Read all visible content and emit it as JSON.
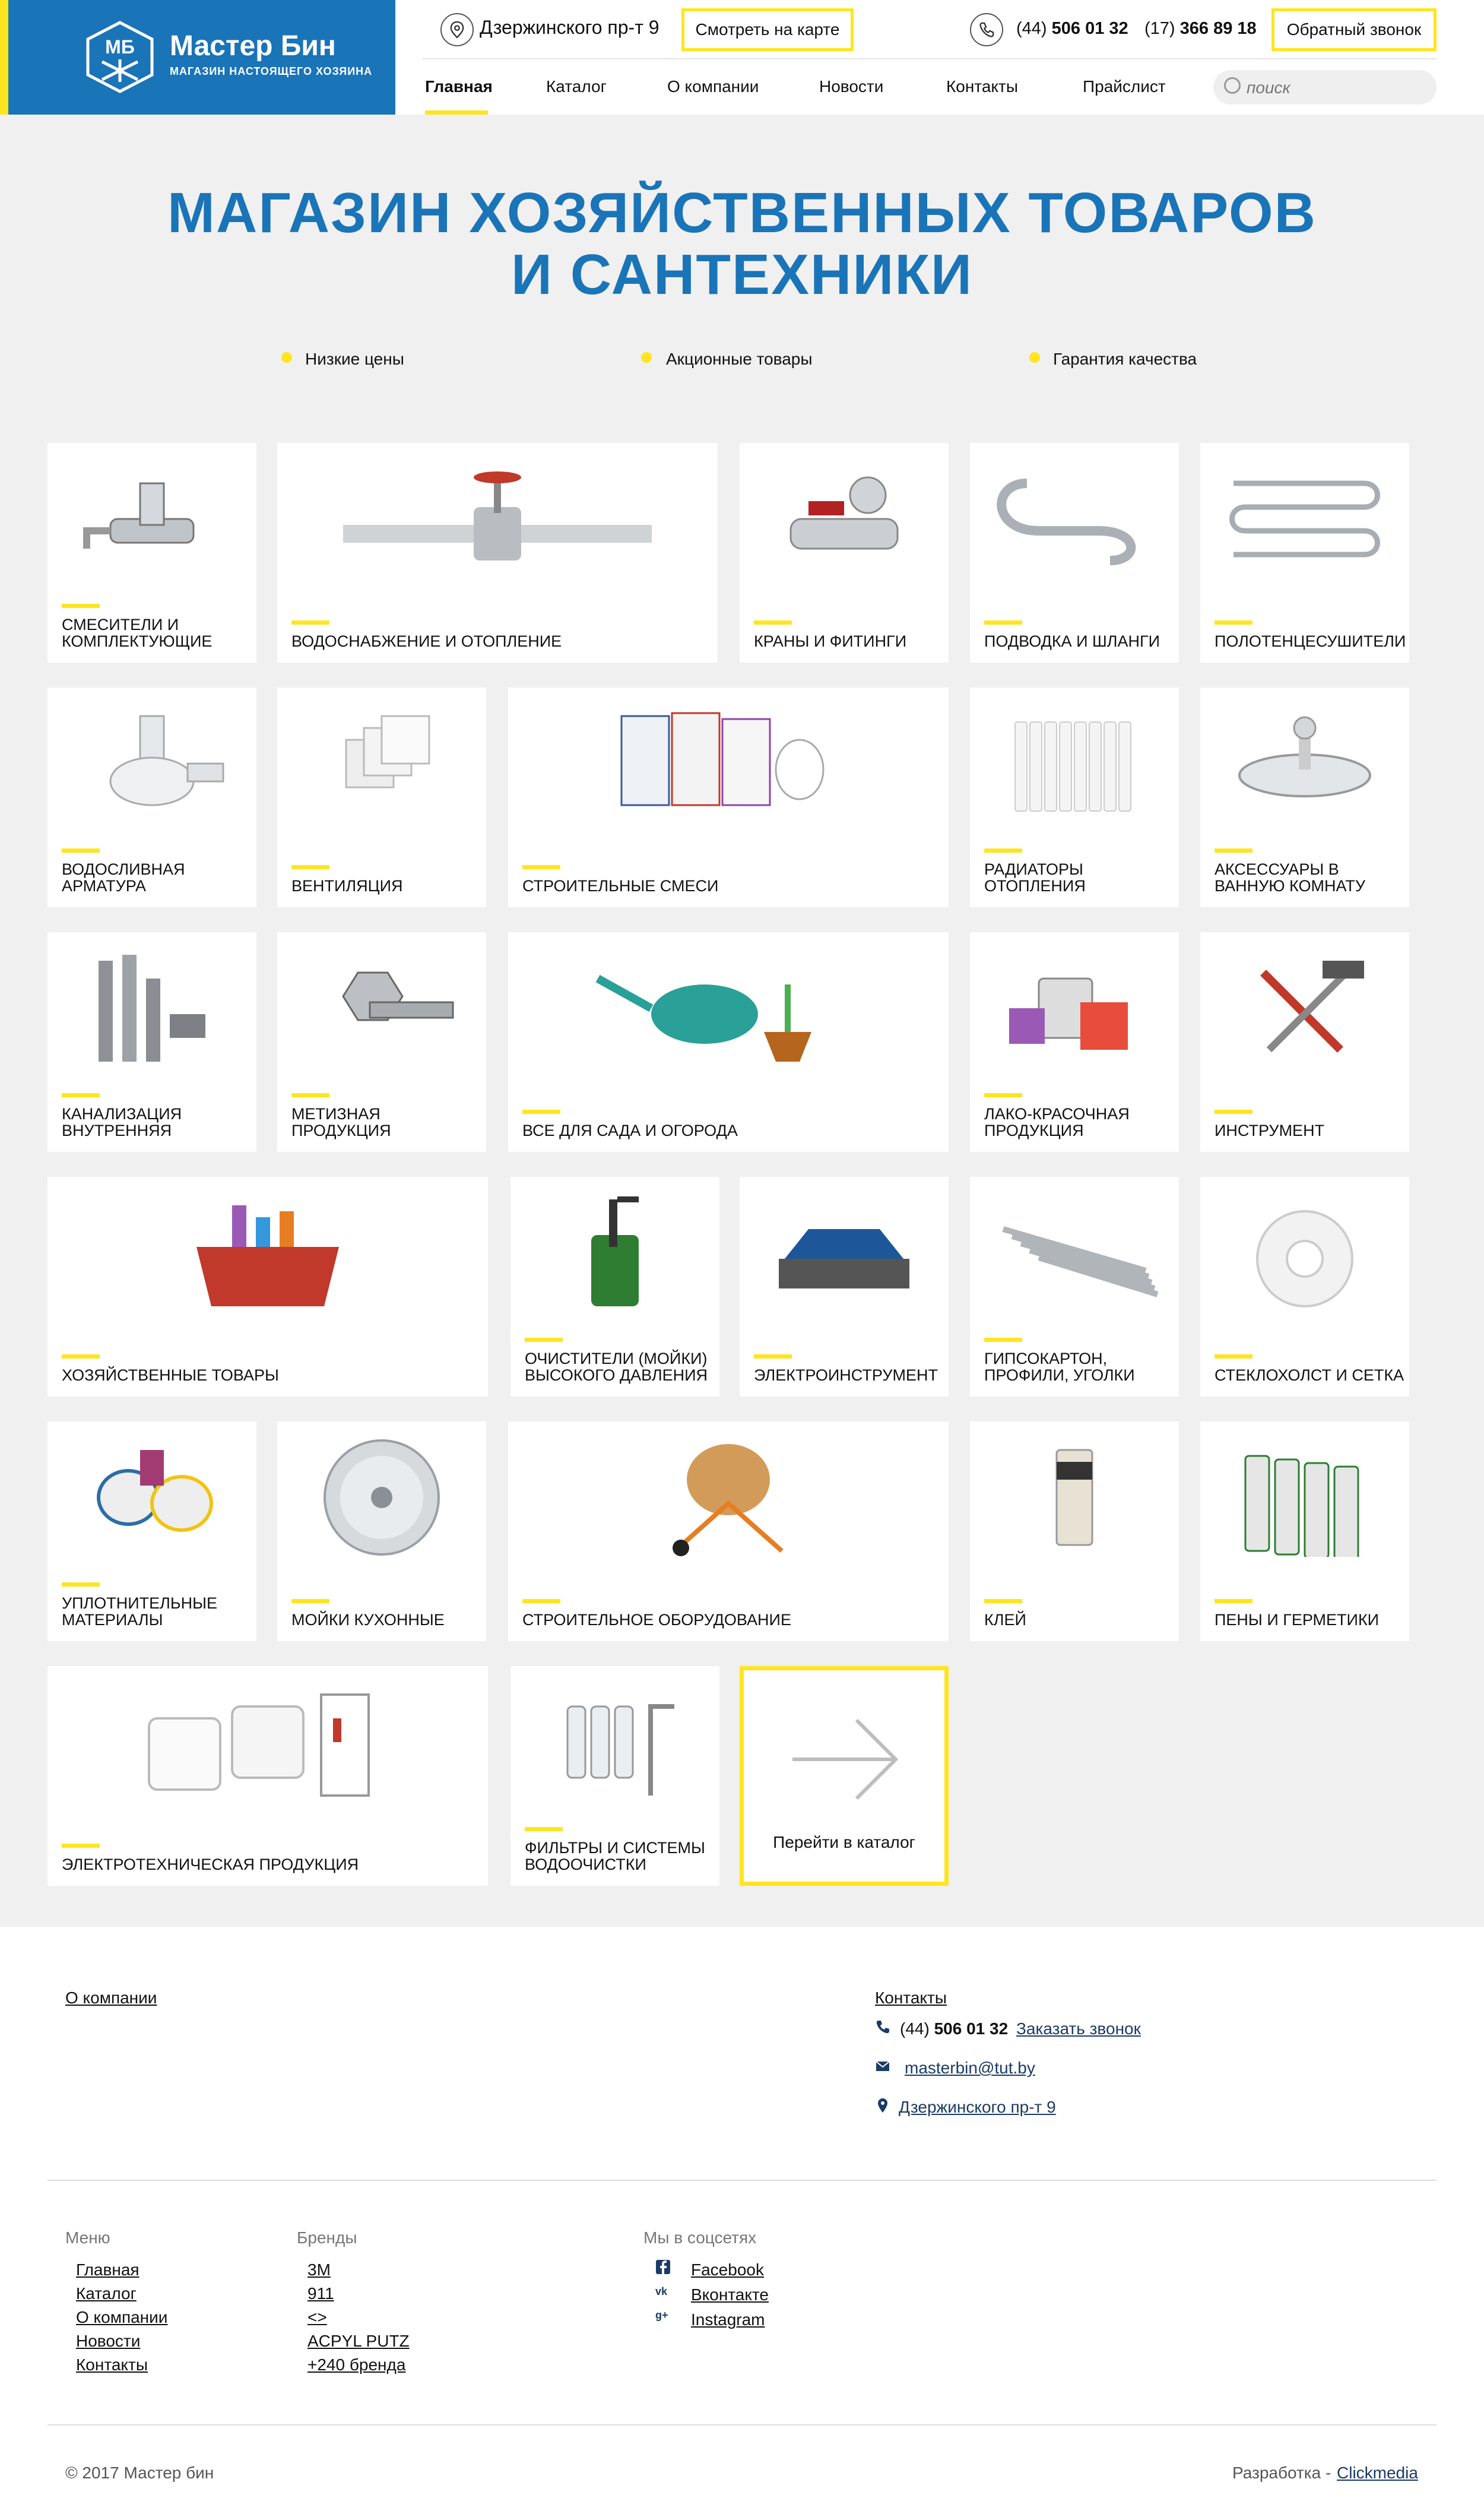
{
  "header": {
    "logo_badge_text": "МБ",
    "logo_title": "Мастер Бин",
    "logo_subtitle": "МАГАЗИН НАСТОЯЩЕГО ХОЗЯИНА",
    "address": "Дзержинского пр-т 9",
    "map_button": "Смотреть на карте",
    "phone1_code": "(44)",
    "phone1_number": "506 01 32",
    "phone2_code": "(17)",
    "phone2_number": "366 89 18",
    "callback_button": "Обратный звонок",
    "search_placeholder": "поиск",
    "accent_color": "#ffe51e",
    "brand_color": "#1a74b8"
  },
  "nav": [
    {
      "label": "Главная",
      "active": true
    },
    {
      "label": "Каталог"
    },
    {
      "label": "О компании"
    },
    {
      "label": "Новости"
    },
    {
      "label": "Контакты"
    },
    {
      "label": "Прайслист"
    }
  ],
  "hero": {
    "title_line1": "МАГАЗИН ХОЗЯЙСТВЕННЫХ ТОВАРОВ",
    "title_line2": "И САНТЕХНИКИ",
    "features": [
      "Низкие цены",
      "Акционные товары",
      "Гарантия качества"
    ]
  },
  "categories": [
    {
      "label": "Смесители и комплектующие",
      "icon": "faucet-icon"
    },
    {
      "label": "Водоснабжение и отопление",
      "icon": "valve-icon"
    },
    {
      "label": "Краны и фитинги",
      "icon": "ball-valve-icon"
    },
    {
      "label": "Подводка и шланги",
      "icon": "hose-icon"
    },
    {
      "label": "Полотенцесушители",
      "icon": "towel-dryer-icon"
    },
    {
      "label": "Водосливная арматура",
      "icon": "siphon-icon"
    },
    {
      "label": "Вентиляция",
      "icon": "vent-grille-icon"
    },
    {
      "label": "Строительные смеси",
      "icon": "mix-bags-icon"
    },
    {
      "label": "Радиаторы отопления",
      "icon": "radiator-icon"
    },
    {
      "label": "Аксессуары в ванную комнату",
      "icon": "soap-dish-icon"
    },
    {
      "label": "Канализация внутренняя",
      "icon": "pipes-icon"
    },
    {
      "label": "Метизная продукция",
      "icon": "bolts-icon"
    },
    {
      "label": "Все для сада и огорода",
      "icon": "watering-can-icon"
    },
    {
      "label": "Лако-красочная продукция",
      "icon": "paint-icon"
    },
    {
      "label": "Инструмент",
      "icon": "tools-icon"
    },
    {
      "label": "Хозяйственные товары",
      "icon": "basket-icon"
    },
    {
      "label": "Очистители (мойки) высокого давления",
      "icon": "pressure-washer-icon"
    },
    {
      "label": "Электроинструмент",
      "icon": "planer-icon"
    },
    {
      "label": "Гипсокартон, профили, уголки",
      "icon": "profiles-icon"
    },
    {
      "label": "Стеклохолст и сетка",
      "icon": "tape-roll-icon"
    },
    {
      "label": "Уплотнительные материалы",
      "icon": "sealing-icon"
    },
    {
      "label": "Мойки кухонные",
      "icon": "sink-icon"
    },
    {
      "label": "Строительное оборудование",
      "icon": "concrete-mixer-icon"
    },
    {
      "label": "Клей",
      "icon": "glue-tube-icon"
    },
    {
      "label": "Пены и герметики",
      "icon": "foam-cans-icon"
    },
    {
      "label": "Электротехническая продукция",
      "icon": "sockets-icon"
    },
    {
      "label": "Фильтры и системы водоочистки",
      "icon": "water-filter-icon"
    }
  ],
  "catalog_link": "Перейти в каталог",
  "footer": {
    "about_link": "О компании",
    "contacts_title": "Контакты",
    "phone_code": "(44)",
    "phone_number": "506 01 32",
    "order_call": "Заказать звонок",
    "email": "masterbin@tut.by",
    "address": "Дзержинского пр-т 9",
    "menu_title": "Меню",
    "menu": [
      "Главная",
      "Каталог",
      "О компании",
      "Новости",
      "Контакты"
    ],
    "brands_title": "Бренды",
    "brands": [
      "3M",
      "911",
      "<>",
      "ACPYL PUTZ",
      "+240 бренда"
    ],
    "social_title": "Мы в соцсетях",
    "social": [
      {
        "label": "Facebook",
        "icon": "facebook-icon"
      },
      {
        "label": "Вконтакте",
        "icon": "vk-icon"
      },
      {
        "label": "Instagram",
        "icon": "google-plus-icon"
      }
    ],
    "copyright": "© 2017 Мастер бин",
    "dev_label": "Разработка -",
    "dev_link": "Clickmedia"
  }
}
